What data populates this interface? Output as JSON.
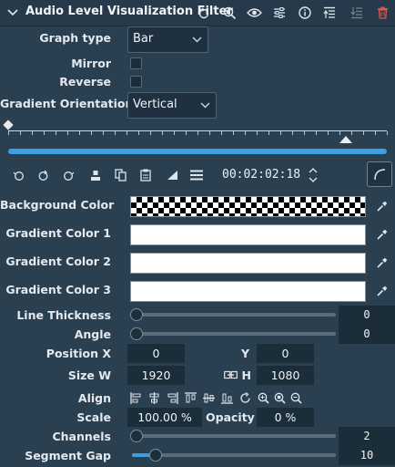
{
  "header": {
    "title": "Audio Level Visualization Filter"
  },
  "graph_type": {
    "label": "Graph type",
    "value": "Bar"
  },
  "mirror": {
    "label": "Mirror",
    "checked": false
  },
  "reverse": {
    "label": "Reverse",
    "checked": false
  },
  "gradient_orientation": {
    "label": "Gradient Orientation",
    "value": "Vertical"
  },
  "timeline": {
    "timecode": "00:02:02:18"
  },
  "colors": {
    "background_label": "Background Color",
    "gradient1_label": "Gradient Color 1",
    "gradient2_label": "Gradient Color 2",
    "gradient3_label": "Gradient Color 3",
    "gradient1": "#ffffff",
    "gradient2": "#ffffff",
    "gradient3": "#ffffff"
  },
  "line_thickness": {
    "label": "Line Thickness",
    "value": "0"
  },
  "angle": {
    "label": "Angle",
    "value": "0"
  },
  "position": {
    "x_label": "Position X",
    "x": "0",
    "y_label": "Y",
    "y": "0"
  },
  "size": {
    "w_label": "Size W",
    "w": "1920",
    "h_label": "H",
    "h": "1080"
  },
  "align": {
    "label": "Align"
  },
  "scale": {
    "label": "Scale",
    "value": "100.00 %",
    "opacity_label": "Opacity",
    "opacity": "0 %"
  },
  "channels": {
    "label": "Channels",
    "value": "2"
  },
  "segment_gap": {
    "label": "Segment Gap",
    "value": "10"
  }
}
